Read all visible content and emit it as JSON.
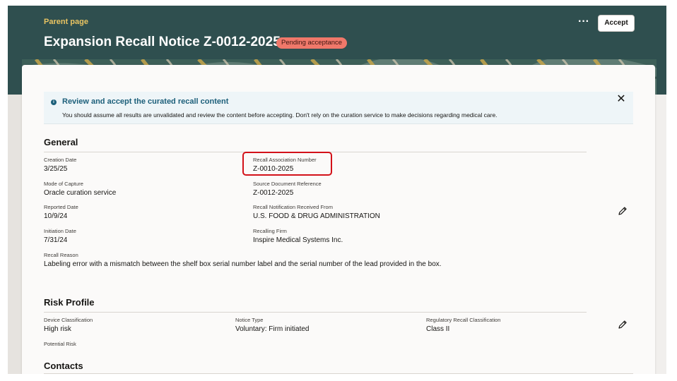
{
  "header": {
    "parent_link": "Parent page",
    "title": "Expansion Recall Notice Z-0012-2025",
    "status_badge": "Pending acceptance",
    "more_icon": "more-horizontal-icon",
    "accept_label": "Accept",
    "background_color": "#2f4f4f",
    "accent_color": "#e9c462"
  },
  "banner": {
    "icon": "info-icon",
    "title": "Review and accept the curated recall content",
    "text": "You should assume all results are unvalidated and review the content before accepting. Don't rely on the curation service to make decisions regarding medical care.",
    "close_icon": "close-icon"
  },
  "general": {
    "title": "General",
    "edit_icon": "pencil-icon",
    "fields": {
      "creation_date": {
        "label": "Creation Date",
        "value": "3/25/25"
      },
      "recall_association_number": {
        "label": "Recall Association Number",
        "value": "Z-0010-2025"
      },
      "mode_of_capture": {
        "label": "Mode of Capture",
        "value": "Oracle curation service"
      },
      "source_document_reference": {
        "label": "Source Document Reference",
        "value": "Z-0012-2025"
      },
      "reported_date": {
        "label": "Reported Date",
        "value": "10/9/24"
      },
      "recall_notification_received_from": {
        "label": "Recall Notification Received From",
        "value": "U.S. FOOD & DRUG ADMINISTRATION"
      },
      "initiation_date": {
        "label": "Initiation Date",
        "value": "7/31/24"
      },
      "recalling_firm": {
        "label": "Recalling Firm",
        "value": "Inspire Medical Systems Inc."
      },
      "recall_reason": {
        "label": "Recall Reason",
        "value": "Labeling error with a mismatch between the shelf box serial number label and the serial number of the lead provided in the box."
      }
    }
  },
  "risk_profile": {
    "title": "Risk Profile",
    "edit_icon": "pencil-icon",
    "fields": {
      "device_classification": {
        "label": "Device Classification",
        "value": "High risk"
      },
      "notice_type": {
        "label": "Notice Type",
        "value": "Voluntary: Firm initiated"
      },
      "regulatory_recall_classification": {
        "label": "Regulatory Recall Classification",
        "value": "Class II"
      },
      "potential_risk": {
        "label": "Potential Risk",
        "value": ""
      }
    }
  },
  "contacts": {
    "title": "Contacts"
  },
  "colors": {
    "highlight": "#d31119",
    "badge": "#f0786a",
    "info": "#1c5f7a"
  }
}
